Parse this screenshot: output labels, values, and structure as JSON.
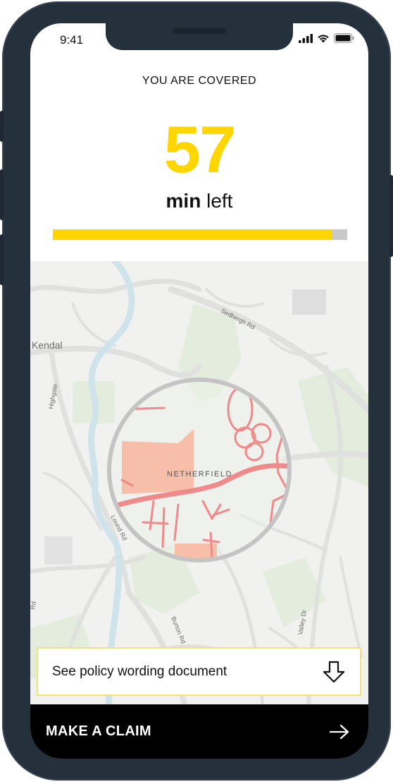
{
  "status_bar": {
    "time": "9:41"
  },
  "coverage": {
    "label": "YOU ARE COVERED",
    "minutes": "57",
    "unit_bold": "min",
    "unit_rest": " left",
    "progress_fraction": 0.95
  },
  "map": {
    "labels": {
      "town": "Kendal",
      "area": "NETHERFIELD",
      "road_sedbergh": "Sedbergh Rd",
      "road_highgate": "Highgate",
      "road_lound": "Lound Rd",
      "road_burton": "Burton Rd",
      "road_valley": "Valley Dr",
      "road_rd": "Rd"
    }
  },
  "actions": {
    "policy_doc_label": "See policy wording document",
    "claim_label": "MAKE A CLAIM"
  },
  "icons": {
    "download": "download-arrow-icon",
    "arrow": "arrow-right-icon"
  },
  "colors": {
    "accent": "#ffd600",
    "claim_bar": "#000000",
    "phone_frame": "#25303d",
    "coverage_circle": "#c4c4c4",
    "map_roads_highlight": "#f08a8a"
  }
}
